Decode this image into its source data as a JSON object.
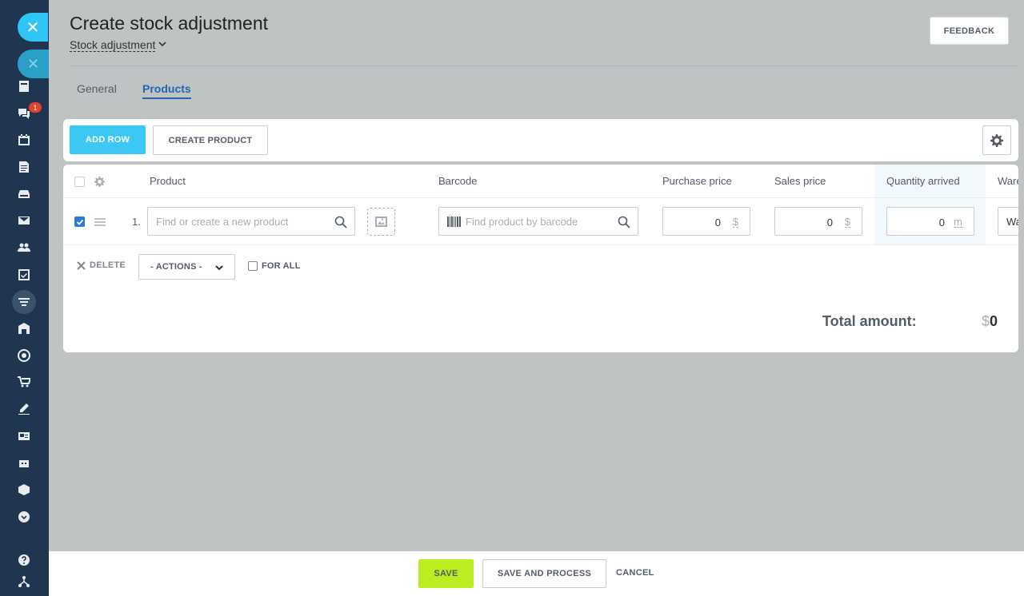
{
  "header": {
    "title": "Create stock adjustment",
    "subtitle": "Stock adjustment",
    "feedback_label": "FEEDBACK"
  },
  "tabs": [
    {
      "label": "General",
      "active": false
    },
    {
      "label": "Products",
      "active": true
    }
  ],
  "sidebar": {
    "badge_count": "1",
    "close_symbol": "✕",
    "items": [
      "feed-icon",
      "chat-icon",
      "calendar-icon",
      "document-icon",
      "drive-icon",
      "mail-icon",
      "group-icon",
      "tasks-icon",
      "crm-filter-icon",
      "store-icon",
      "target-icon",
      "cart-icon",
      "sign-icon",
      "contact-card-icon",
      "robot-icon",
      "box-icon",
      "more-icon",
      "help-icon",
      "structure-icon"
    ]
  },
  "toolbar": {
    "add_row_label": "ADD ROW",
    "create_product_label": "CREATE PRODUCT"
  },
  "table": {
    "columns": [
      "Product",
      "Barcode",
      "Purchase price",
      "Sales price",
      "Quantity arrived",
      "Ware"
    ],
    "rows": [
      {
        "index": "1.",
        "checked": true,
        "product_placeholder": "Find or create a new product",
        "barcode_placeholder": "Find product by barcode",
        "purchase_price": "0",
        "purchase_currency": "$",
        "sales_price": "0",
        "sales_currency": "$",
        "quantity": "0",
        "quantity_unit": "m",
        "warehouse": "Wa"
      }
    ]
  },
  "row_actions": {
    "delete_label": "DELETE",
    "actions_label": "- ACTIONS -",
    "for_all_label": "FOR ALL"
  },
  "total": {
    "label": "Total amount:",
    "currency": "$",
    "value": "0"
  },
  "footer": {
    "save_label": "SAVE",
    "save_process_label": "SAVE AND PROCESS",
    "cancel_label": "CANCEL"
  },
  "colors": {
    "accent_blue": "#3bc8f5",
    "save_green": "#bbed21",
    "sidebar_bg": "#1f3550",
    "active_tab": "#2067b0"
  }
}
